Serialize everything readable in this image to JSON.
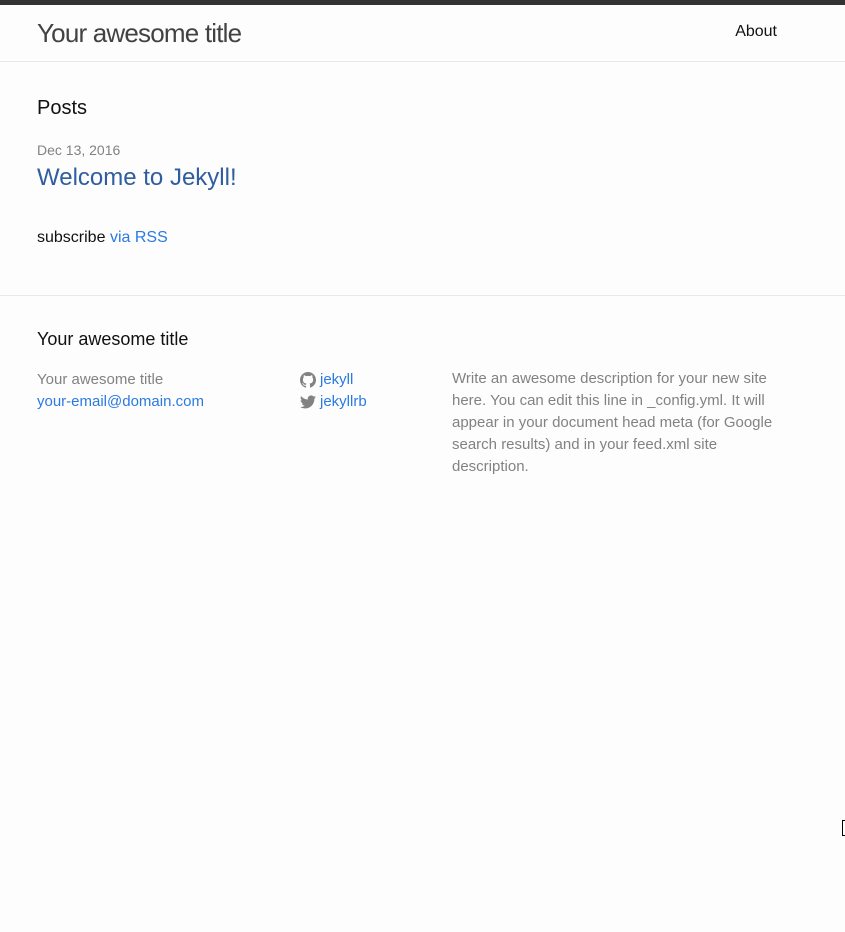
{
  "header": {
    "site_title": "Your awesome title",
    "nav": [
      {
        "label": "About"
      }
    ]
  },
  "main": {
    "page_heading": "Posts",
    "posts": [
      {
        "date": "Dec 13, 2016",
        "title": "Welcome to Jekyll!"
      }
    ],
    "rss": {
      "prefix": "subscribe",
      "link_label": "via RSS"
    }
  },
  "footer": {
    "heading": "Your awesome title",
    "site_name": "Your awesome title",
    "email": "your-email@domain.com",
    "social": [
      {
        "icon": "github-icon",
        "label": "jekyll"
      },
      {
        "icon": "twitter-icon",
        "label": "jekyllrb"
      }
    ],
    "description": "Write an awesome description for your new site here. You can edit this line in _config.yml. It will appear in your document head meta (for Google search results) and in your feed.xml site description."
  },
  "colors": {
    "link": "#2a7ae2",
    "post_link": "#2f5d9f",
    "muted": "#828282",
    "header_border_top": "#333333"
  }
}
